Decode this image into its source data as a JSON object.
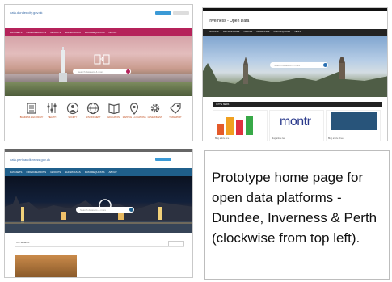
{
  "panels": {
    "dundee": {
      "logo_text": "data.dundeecity.gov.uk",
      "nav": [
        "DATASETS",
        "ORGANISATIONS",
        "GROUPS",
        "SHOWCASES",
        "DATA REQUESTS",
        "ABOUT"
      ],
      "search_placeholder": "Search datasets & more",
      "icons": [
        {
          "icon": "building-icon",
          "label": "BUSINESS & ECONOMY"
        },
        {
          "icon": "sliders-icon",
          "label": "HEALTH"
        },
        {
          "icon": "person-icon",
          "label": "SOCIETY"
        },
        {
          "icon": "globe-icon",
          "label": "ENVIRONMENT"
        },
        {
          "icon": "book-icon",
          "label": "EDUCATION"
        },
        {
          "icon": "map-pin-icon",
          "label": "MAPPING & LOCATIONS"
        },
        {
          "icon": "gear-icon",
          "label": "GOVERNMENT"
        },
        {
          "icon": "tag-icon",
          "label": "TRANSPORT"
        }
      ],
      "brand_color": "#b5225a"
    },
    "inverness": {
      "title": "Inverness - Open Data",
      "nav": [
        "DATASETS",
        "ORGANISATIONS",
        "GROUPS",
        "SHOWCASES",
        "DATA REQUESTS",
        "ABOUT"
      ],
      "search_placeholder": "Search datasets & more",
      "news_label": "IN THE NEWS",
      "card_labels": [
        "Blog article one",
        "Blog article two",
        "Blog article three"
      ],
      "logo_word": "montr"
    },
    "perth": {
      "logo_text": "data.perthandkinross.gov.uk",
      "nav": [
        "DATASETS",
        "ORGANISATIONS",
        "GROUPS",
        "SHOWCASES",
        "DATA REQUESTS",
        "ABOUT"
      ],
      "search_placeholder": "Search datasets & more",
      "news_label": "IN THE NEWS",
      "more_label": "More news",
      "brand_color": "#1f5f8b"
    }
  },
  "caption": "Prototype home page for open data platforms - Dundee, Inverness & Perth (clockwise from top left)."
}
